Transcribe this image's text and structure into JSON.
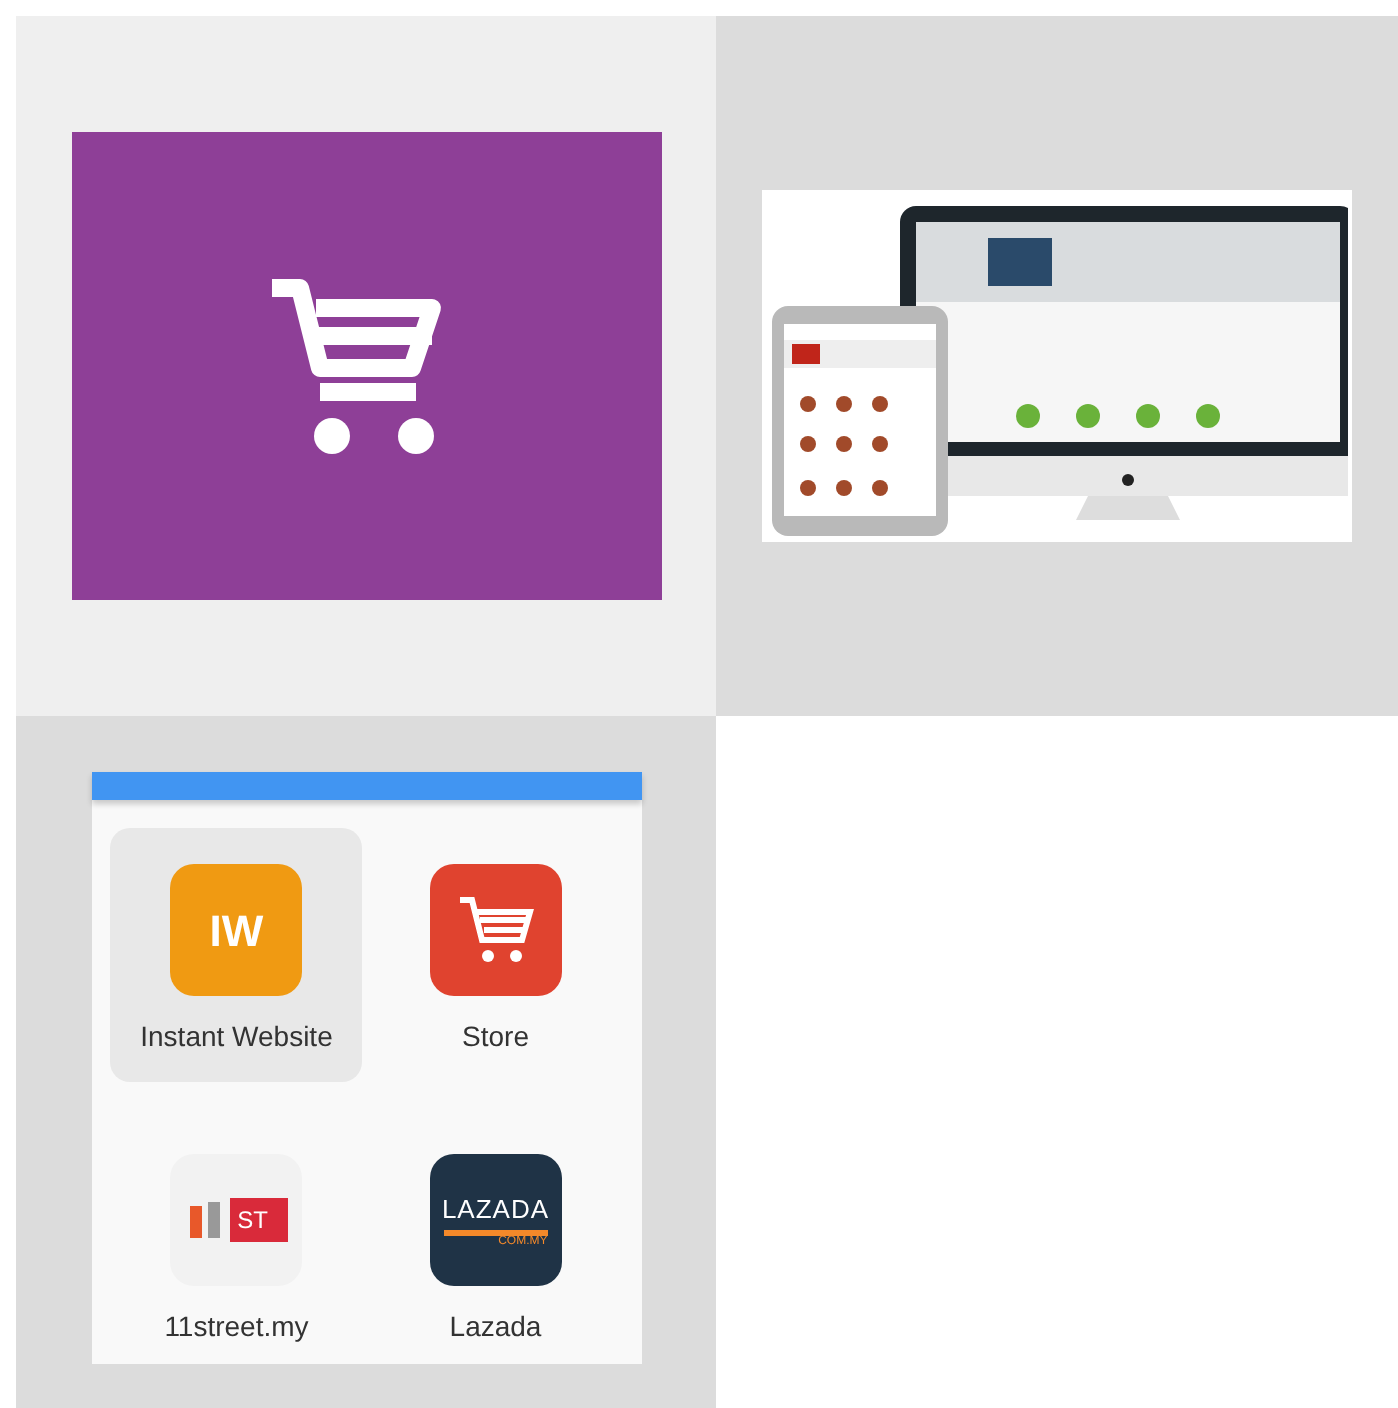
{
  "tiles": [
    {
      "kind": "cart_logo"
    },
    {
      "kind": "devices_mockup"
    },
    {
      "kind": "app_grid"
    }
  ],
  "app_grid": {
    "apps": [
      {
        "kind": "iw",
        "label": "Instant Website",
        "icon_text": "IW",
        "selected": true
      },
      {
        "kind": "cart",
        "label": "Store",
        "selected": false
      },
      {
        "kind": "elevenst",
        "label": "11street.my",
        "icon_text": "ST",
        "selected": false
      },
      {
        "kind": "lazada",
        "label": "Lazada",
        "icon_text": "LAZADA",
        "icon_subtext": "COM.MY",
        "selected": false
      }
    ]
  }
}
